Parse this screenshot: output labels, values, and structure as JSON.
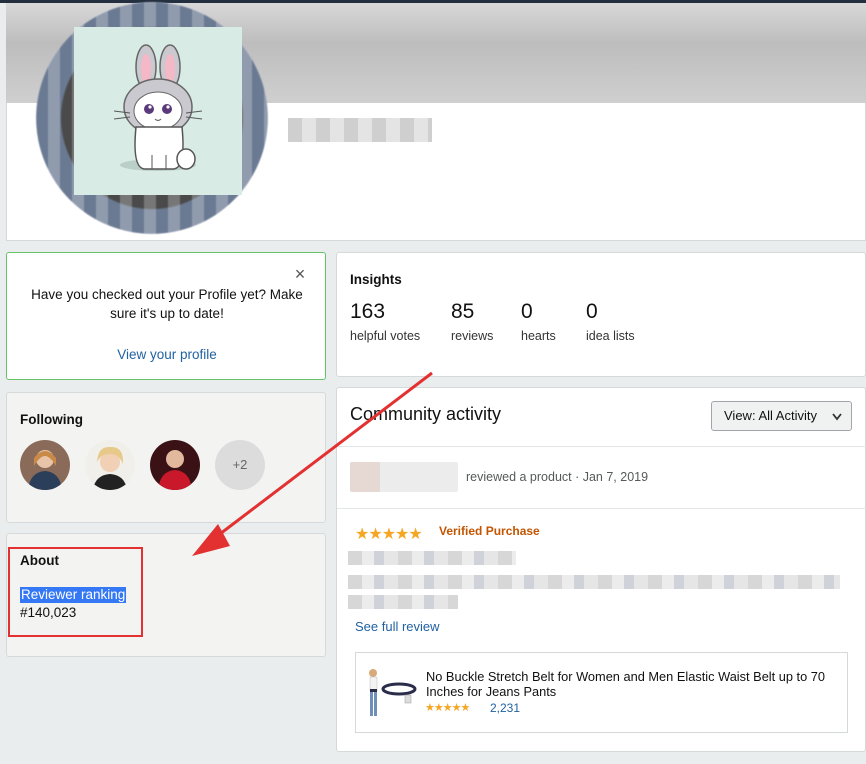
{
  "header": {},
  "profile_prompt": {
    "text": "Have you checked out your Profile yet? Make sure it's up to date!",
    "link_label": "View your profile",
    "close_label": "×"
  },
  "following": {
    "title": "Following",
    "more_label": "+2"
  },
  "about": {
    "title": "About",
    "rank_label": "Reviewer ranking",
    "rank_value": "#140,023"
  },
  "insights": {
    "title": "Insights",
    "stats": [
      {
        "value": "163",
        "label": "helpful votes"
      },
      {
        "value": "85",
        "label": "reviews"
      },
      {
        "value": "0",
        "label": "hearts"
      },
      {
        "value": "0",
        "label": "idea lists"
      }
    ]
  },
  "community": {
    "title": "Community activity",
    "view_label": "View:",
    "view_value": "All Activity",
    "activity_text": "reviewed a product · Jan 7, 2019",
    "verified_label": "Verified Purchase",
    "see_full_label": "See full review",
    "product": {
      "title": "No Buckle Stretch Belt for Women and Men Elastic Waist Belt up to 70 Inches for Jeans Pants",
      "rating_count": "2,231"
    }
  },
  "colors": {
    "link": "#2162a1",
    "verified": "#c45500",
    "star": "#f5a623",
    "annotation_red": "#e33030",
    "prompt_border": "#67c267",
    "selection": "#3478f6"
  },
  "icons": [
    "close-icon",
    "chevron-down-icon",
    "star-icon"
  ]
}
